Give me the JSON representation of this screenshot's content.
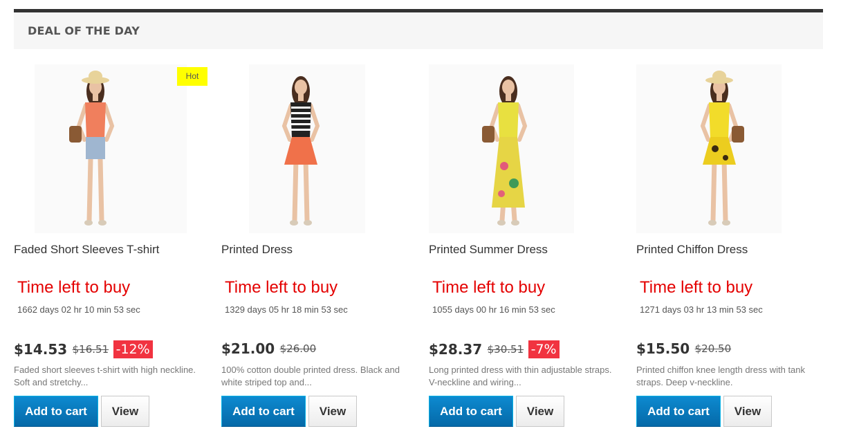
{
  "section": {
    "title": "DEAL OF THE DAY"
  },
  "products": [
    {
      "name": "Faded Short Sleeves T-shirt",
      "badge": "Hot",
      "time_title": "Time left to buy",
      "time_left": "1662 days 02 hr 10 min 53 sec",
      "price": "$14.53",
      "old_price": "$16.51",
      "discount": "-12%",
      "description": "Faded short sleeves t-shirt with high neckline. Soft and stretchy...",
      "add_to_cart": "Add to cart",
      "view": "View",
      "image": {
        "top_color": "#f07f5d",
        "bottom_color": "#9fb6d0",
        "hat": true,
        "bag": true
      }
    },
    {
      "name": "Printed Dress",
      "time_title": "Time left to buy",
      "time_left": "1329 days 05 hr 18 min 53 sec",
      "price": "$21.00",
      "old_price": "$26.00",
      "description": "100% cotton double printed dress. Black and white striped top and...",
      "add_to_cart": "Add to cart",
      "view": "View",
      "image": {
        "top_color": "#222222",
        "bottom_color": "#f0714a",
        "hat": false,
        "bag": false
      }
    },
    {
      "name": "Printed Summer Dress",
      "time_title": "Time left to buy",
      "time_left": "1055 days 00 hr 16 min 53 sec",
      "price": "$28.37",
      "old_price": "$30.51",
      "discount": "-7%",
      "description": "Long printed dress with thin adjustable straps. V-neckline and wiring...",
      "add_to_cart": "Add to cart",
      "view": "View",
      "image": {
        "top_color": "#e8e040",
        "bottom_color": "#e6d545",
        "hat": false,
        "bag": true
      }
    },
    {
      "name": "Printed Chiffon Dress",
      "time_title": "Time left to buy",
      "time_left": "1271 days 03 hr 13 min 53 sec",
      "price": "$15.50",
      "old_price": "$20.50",
      "description": "Printed chiffon knee length dress with tank straps. Deep v-neckline.",
      "add_to_cart": "Add to cart",
      "view": "View",
      "image": {
        "top_color": "#f2dc2a",
        "bottom_color": "#eccd1f",
        "hat": true,
        "bag": true
      }
    }
  ]
}
